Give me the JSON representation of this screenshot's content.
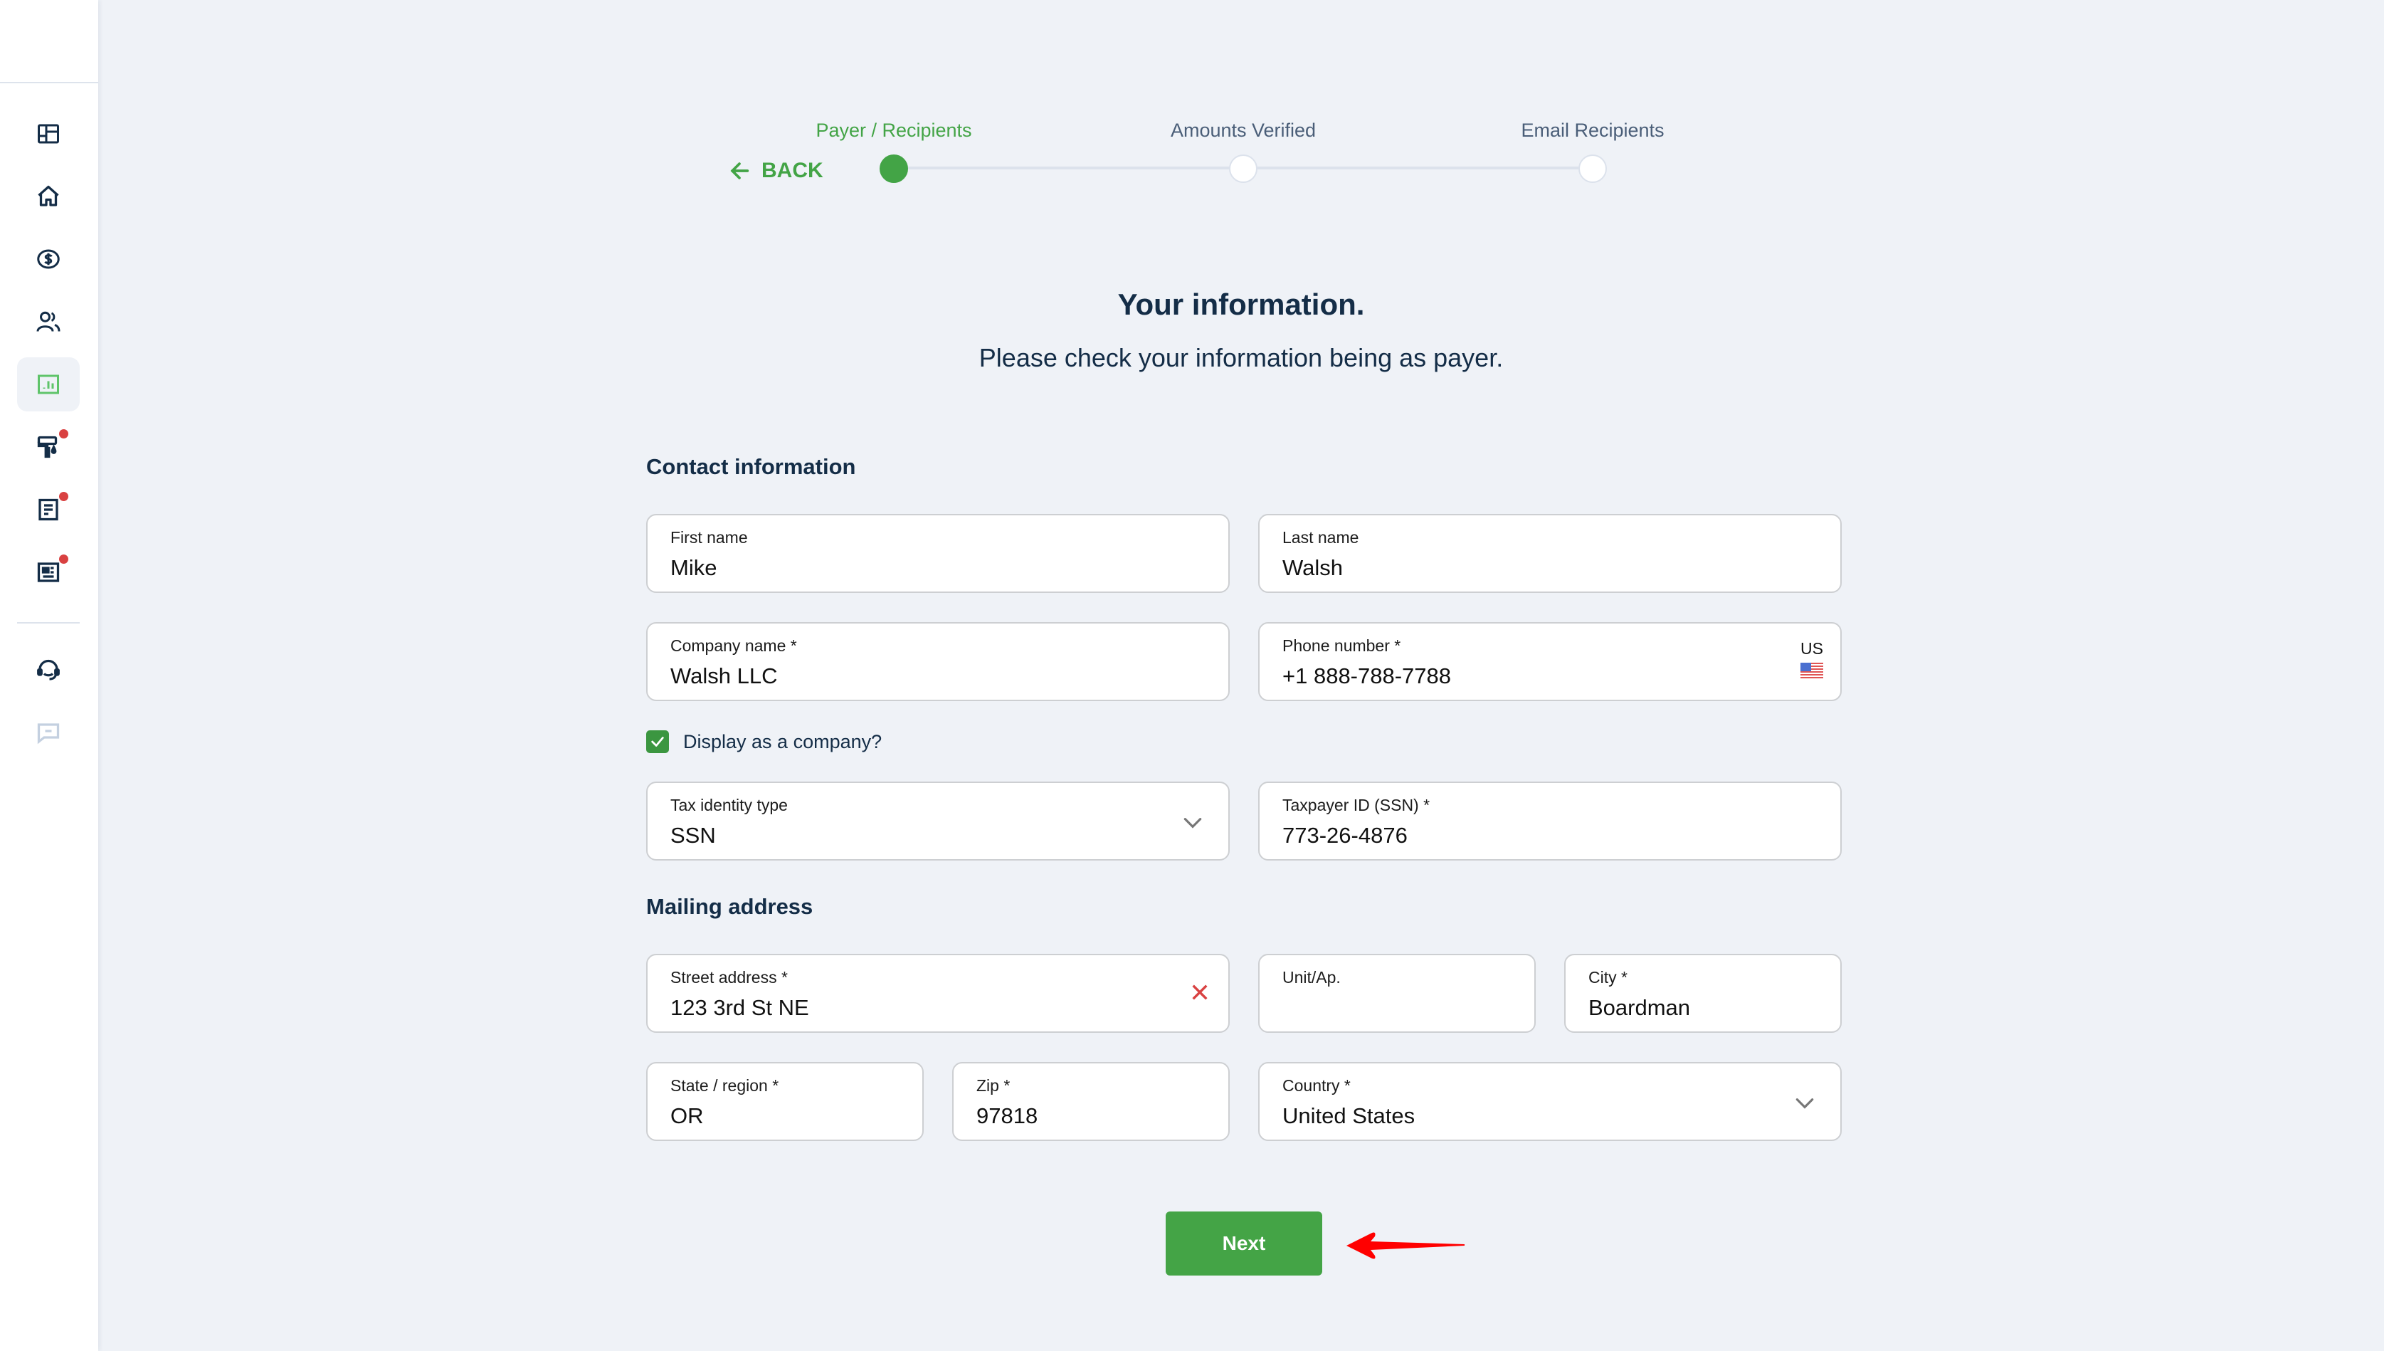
{
  "sidebar": {
    "items": [
      {
        "id": "dashboard",
        "icon": "dashboard-grid-icon",
        "active": false,
        "badge": false
      },
      {
        "id": "home",
        "icon": "home-icon",
        "active": false,
        "badge": false
      },
      {
        "id": "payments",
        "icon": "dollar-circle-icon",
        "active": false,
        "badge": false
      },
      {
        "id": "contacts",
        "icon": "users-icon",
        "active": false,
        "badge": false
      },
      {
        "id": "reports",
        "icon": "bar-chart-icon",
        "active": true,
        "badge": false
      },
      {
        "id": "customize",
        "icon": "paint-roller-icon",
        "active": false,
        "badge": true
      },
      {
        "id": "documents",
        "icon": "document-icon",
        "active": false,
        "badge": true
      },
      {
        "id": "forms",
        "icon": "id-card-icon",
        "active": false,
        "badge": true
      },
      {
        "id": "support",
        "icon": "headset-icon",
        "active": false,
        "badge": false
      },
      {
        "id": "chat",
        "icon": "chat-icon",
        "active": false,
        "badge": false
      }
    ]
  },
  "stepper": {
    "back_label": "BACK",
    "steps": [
      {
        "label": "Payer / Recipients",
        "active": true
      },
      {
        "label": "Amounts Verified",
        "active": false
      },
      {
        "label": "Email Recipients",
        "active": false
      }
    ]
  },
  "header": {
    "title": "Your information.",
    "subtitle": "Please check your information being as payer."
  },
  "contact": {
    "section_title": "Contact information",
    "first_name": {
      "label": "First name",
      "value": "Mike"
    },
    "last_name": {
      "label": "Last name",
      "value": "Walsh"
    },
    "company_name": {
      "label": "Company name *",
      "value": "Walsh LLC"
    },
    "phone": {
      "label": "Phone number *",
      "value": "+1 888-788-7788",
      "country_code": "US",
      "flag_icon": "us-flag-icon"
    },
    "display_as_company": {
      "label": "Display as a company?",
      "checked": true
    },
    "tax_identity_type": {
      "label": "Tax identity type",
      "value": "SSN"
    },
    "taxpayer_id": {
      "label": "Taxpayer ID (SSN) *",
      "value": "773-26-4876"
    }
  },
  "mailing": {
    "section_title": "Mailing address",
    "street": {
      "label": "Street address *",
      "value": "123 3rd St NE"
    },
    "unit": {
      "label": "Unit/Ap.",
      "value": ""
    },
    "city": {
      "label": "City *",
      "value": "Boardman"
    },
    "state": {
      "label": "State / region *",
      "value": "OR"
    },
    "zip": {
      "label": "Zip *",
      "value": "97818"
    },
    "country": {
      "label": "Country *",
      "value": "United States"
    }
  },
  "actions": {
    "next_label": "Next"
  },
  "colors": {
    "accent": "#44a446",
    "text": "#142d47",
    "badge": "#d94141",
    "background": "#eff2f7"
  }
}
